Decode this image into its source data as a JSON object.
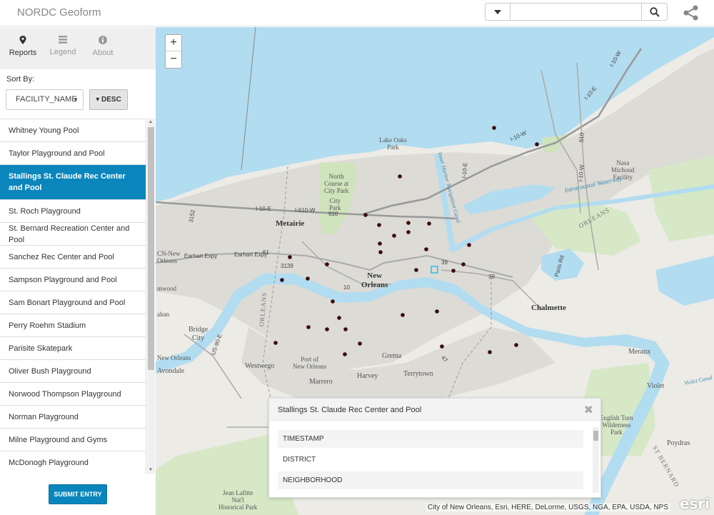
{
  "header": {
    "title": "NORDC Geoform",
    "search_placeholder": ""
  },
  "tabs": [
    {
      "label": "Reports",
      "icon": "map-pin-icon"
    },
    {
      "label": "Legend",
      "icon": "list-icon"
    },
    {
      "label": "About",
      "icon": "info-icon"
    }
  ],
  "sort": {
    "label": "Sort By:",
    "field": "FACILITY_NAME",
    "order_label": "▾ DESC"
  },
  "facilities": [
    "Whitney Young Pool",
    "Taylor Playground and Pool",
    "Stallings St. Claude Rec Center and Pool",
    "St. Roch Playground",
    "St. Bernard Recreation Center and Pool",
    "Sanchez Rec Center and Pool",
    "Sampson Playground and Pool",
    "Sam Bonart Playground and Pool",
    "Perry Roehm Stadium",
    "Parisite Skatepark",
    "Oliver Bush Playground",
    "Norwood Thompson Playground",
    "Norman Playground",
    "Milne Playground and Gyms",
    "McDonogh Playground"
  ],
  "selected_index": 2,
  "submit_label": "SUBMIT ENTRY",
  "map": {
    "zoom_in": "+",
    "zoom_out": "−",
    "labels": {
      "metairie": "Metairie",
      "new_orleans": "New\nOrleans",
      "chalmette": "Chalmette",
      "lake_oaks_park": "Lake Oaks\nPark",
      "north_course": "North\nCourse at\nCity Park",
      "city_park": "City\nPark",
      "nasa": "Nasa\nMichoud\nFacility",
      "intracoastal": "Intracoastal Waterway",
      "inner_harbor": "Inner Harbor Navigation Canal",
      "cn_new_orleans": "CN-New\nOrleans",
      "elmwood": "mwood",
      "jahan": "ahan",
      "bridge_city": "Bridge\nCity",
      "new_orleans_w": "New Orleans",
      "avondale": "Avondale",
      "westwego": "Westwego",
      "marrero": "Marrero",
      "harvey": "Harvey",
      "terrytown": "Terrytown",
      "gretna": "Gretna",
      "port_of_no": "Port of\nNew Orleans",
      "meraux": "Meraux",
      "violet": "Violet",
      "violet_canal": "Violet Canal",
      "poydras": "Poydras",
      "english_turn": "English Turn\nWilderness\nPark",
      "jean_lafitte": "Jean Lafitte\nNat'l\nHistorical Park",
      "orleans_parish": "ORLEANS",
      "orleans_e": "ORLEANS",
      "st_bernard": "ST BERNARD"
    },
    "roads": {
      "i10w_1": "I-10-W",
      "i10e_1": "I-10-E",
      "i10w_2": "I-10-W",
      "i10e_2": "I-10-E",
      "i610w": "I-610-W",
      "i10e_3": "I-10-E",
      "r610": "610",
      "r61": "61",
      "earhart": "Earhart Expy",
      "earhart2": "Earhart Expy",
      "r3139": "3139",
      "r39a": "39",
      "r39b": "39",
      "r10": "10",
      "r3152": "3152",
      "r510": "510",
      "i10w_3": "I-10-W",
      "parisrd": "Paris Rd",
      "r90": "US-90-E",
      "r47": "47"
    },
    "attribution": "City of New Orleans, Esri, HERE, DeLorme, USGS, NGA, EPA, USDA, NPS",
    "esri": "esri"
  },
  "popup": {
    "title": "Stallings St. Claude Rec Center and Pool",
    "fields": [
      "TIMESTAMP",
      "DISTRICT",
      "NEIGHBORHOOD"
    ]
  },
  "colors": {
    "accent": "#0a86bd",
    "water": "#b2dcf0",
    "land": "#ecebe6",
    "urban": "#d9d8d4",
    "park": "#d6e8c6",
    "marker": "#3a0a0a"
  }
}
